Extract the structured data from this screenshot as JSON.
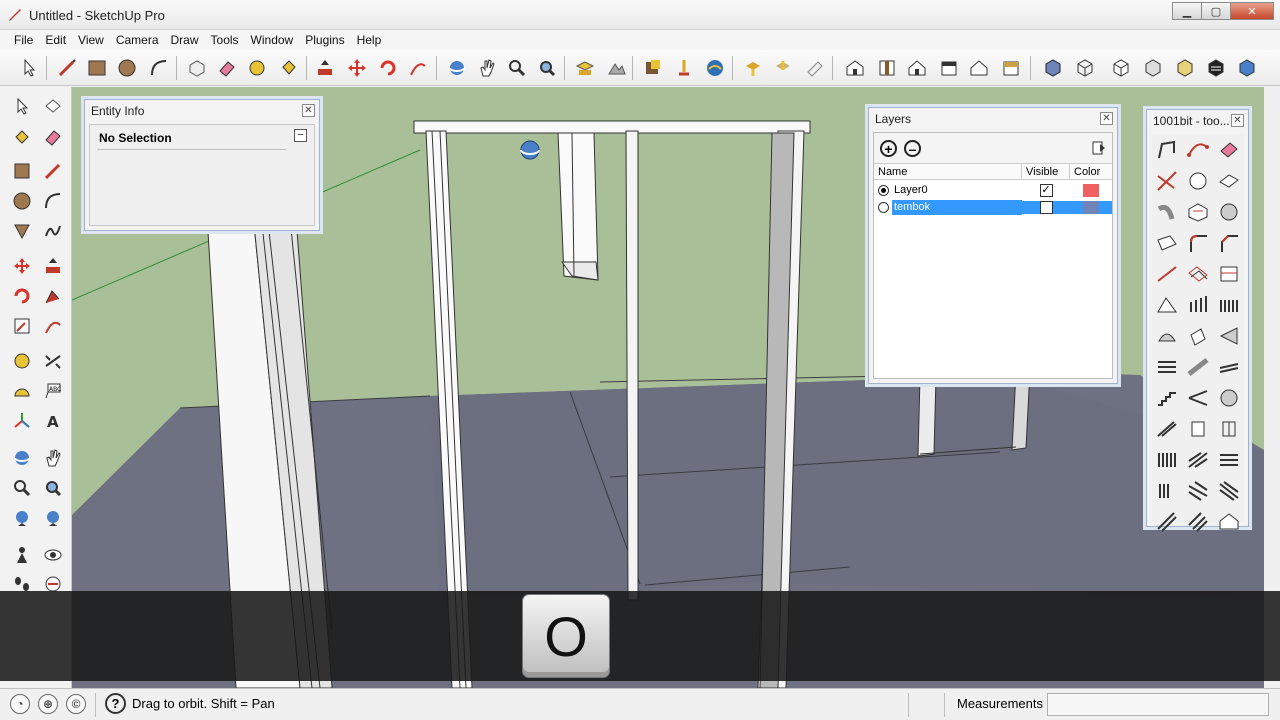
{
  "window": {
    "title": "Untitled - SketchUp Pro"
  },
  "menu": [
    "File",
    "Edit",
    "View",
    "Camera",
    "Draw",
    "Tools",
    "Window",
    "Plugins",
    "Help"
  ],
  "entity_info": {
    "title": "Entity Info",
    "selection": "No Selection"
  },
  "layers": {
    "title": "Layers",
    "columns": {
      "name": "Name",
      "visible": "Visible",
      "color": "Color"
    },
    "rows": [
      {
        "name": "Layer0",
        "active": true,
        "visible": true,
        "color": "#f06060"
      },
      {
        "name": "tembok",
        "active": false,
        "visible": false,
        "color": "#6f84b8",
        "selected": true
      }
    ]
  },
  "plugin_palette": {
    "title": "1001bit - too..."
  },
  "key_overlay": {
    "key": "O"
  },
  "status": {
    "hint": "Drag to orbit.  Shift = Pan",
    "measurements_label": "Measurements",
    "measurements_value": ""
  },
  "colors": {
    "sky": "#a9bf97",
    "ground": "#6e7182",
    "panel_border": "#9fb4cc",
    "selection": "#3399ff"
  }
}
